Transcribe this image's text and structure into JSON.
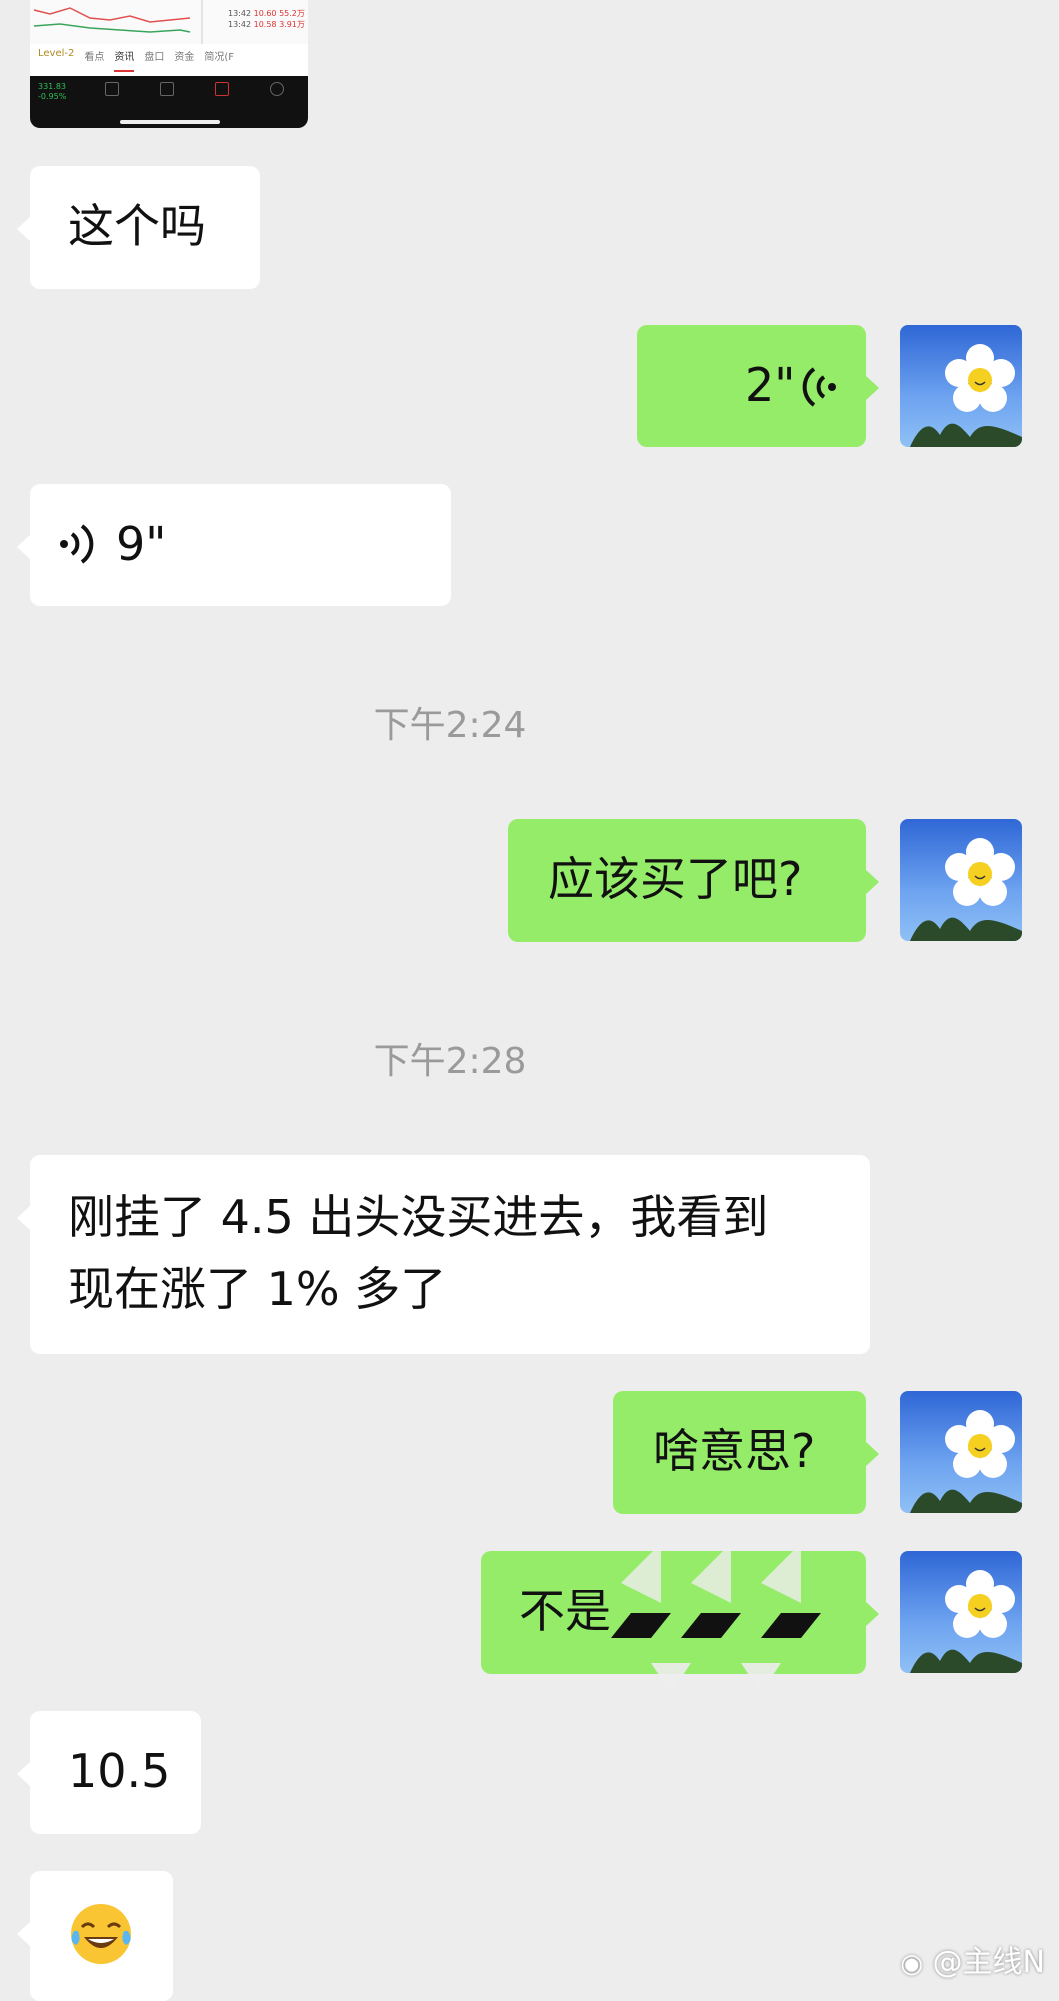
{
  "thumbnail": {
    "tabs": [
      "Level-2",
      "看点",
      "资讯",
      "盘口",
      "资金",
      "简况(F"
    ],
    "rows": [
      {
        "time": "13:42",
        "price": "10.60",
        "vol": "55.2万"
      },
      {
        "time": "13:42",
        "price": "10.58",
        "vol": "3.91万"
      }
    ],
    "bottom_items": [
      "331.83",
      "-0.95%"
    ]
  },
  "messages": [
    {
      "id": "m1",
      "side": "in",
      "type": "text",
      "text": "这个吗"
    },
    {
      "id": "m2",
      "side": "out",
      "type": "voice",
      "duration": "2\""
    },
    {
      "id": "m3",
      "side": "in",
      "type": "voice",
      "duration": "9\""
    },
    {
      "id": "t1",
      "type": "time",
      "text": "下午2:24"
    },
    {
      "id": "m4",
      "side": "out",
      "type": "text",
      "text": "应该买了吧?"
    },
    {
      "id": "t2",
      "type": "time",
      "text": "下午2:28"
    },
    {
      "id": "m5",
      "side": "in",
      "type": "text",
      "lines": [
        "刚挂了 4.5 出头没买进去，我看到",
        "现在涨了 1% 多了"
      ]
    },
    {
      "id": "m6",
      "side": "out",
      "type": "text",
      "text": "啥意思?"
    },
    {
      "id": "m7",
      "side": "out",
      "type": "text",
      "text": "不是"
    },
    {
      "id": "m8",
      "side": "in",
      "type": "text",
      "text": "10.5"
    },
    {
      "id": "m9",
      "side": "in",
      "type": "emoji",
      "icon": "tears-of-joy-emoji",
      "glyph": "😂"
    }
  ],
  "watermark": "@主线N",
  "colors": {
    "background": "#ededed",
    "incoming_bubble": "#ffffff",
    "outgoing_bubble": "#95ec69",
    "timestamp": "#9a9a9a"
  }
}
